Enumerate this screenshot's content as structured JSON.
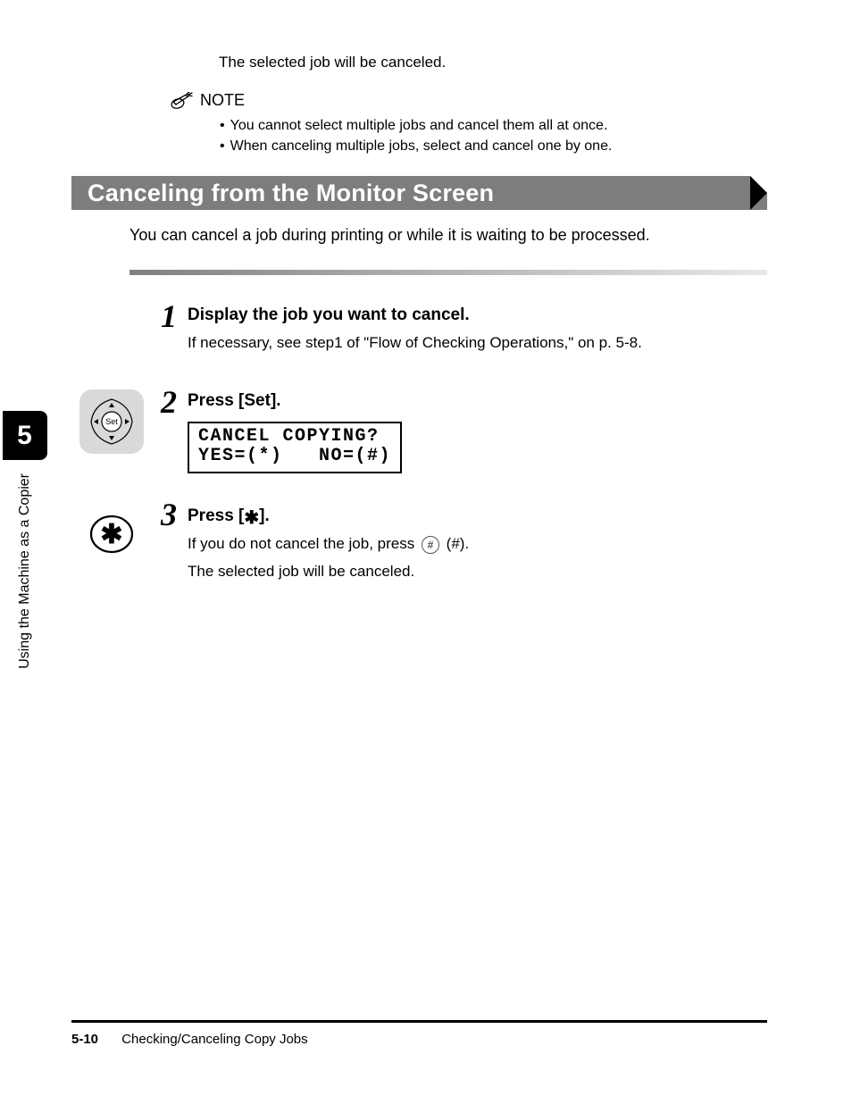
{
  "top_result": "The selected job will be canceled.",
  "note": {
    "label": "NOTE",
    "items": [
      "You cannot select multiple jobs and cancel them all at once.",
      "When canceling multiple jobs, select and cancel one by one."
    ]
  },
  "section_title": "Canceling from the Monitor Screen",
  "section_intro": "You can cancel a job during printing or while it is waiting to be processed.",
  "steps": {
    "s1": {
      "num": "1",
      "head": "Display the job you want to cancel.",
      "body": "If necessary, see step1 of \"Flow of Checking Operations,\" on p. 5-8."
    },
    "s2": {
      "num": "2",
      "head": "Press [Set].",
      "lcd_line1": "CANCEL COPYING?",
      "lcd_line2": "YES=(*)   NO=(#)"
    },
    "s3": {
      "num": "3",
      "head_before": "Press [",
      "head_star": "✱",
      "head_after": "].",
      "body1_before": "If you do not cancel the job, press ",
      "body1_after": " (#).",
      "body2": "The selected job will be canceled."
    }
  },
  "sidebar": {
    "chapter_num": "5",
    "chapter_title": "Using the Machine as a Copier"
  },
  "footer": {
    "page": "5-10",
    "title": "Checking/Canceling Copy Jobs"
  }
}
